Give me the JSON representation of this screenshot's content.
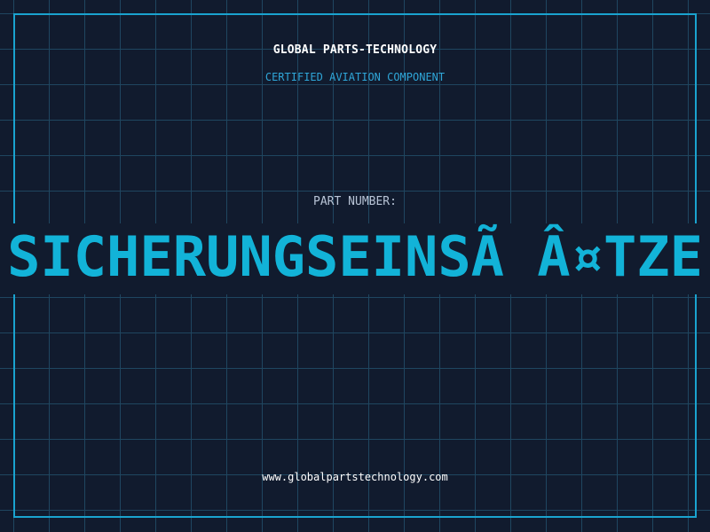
{
  "header": {
    "company": "GLOBAL PARTS-TECHNOLOGY",
    "subtitle": "CERTIFIED AVIATION COMPONENT"
  },
  "part": {
    "label": "PART NUMBER:",
    "number": "SICHERUNGSEINSÃ Â¤TZE"
  },
  "footer": {
    "website": "www.globalpartstechnology.com"
  },
  "colors": {
    "background": "#111b2e",
    "grid": "#1f4660",
    "frame": "#1aa3cf",
    "accent": "#12b3d8",
    "subtitle": "#2fa6d8"
  }
}
